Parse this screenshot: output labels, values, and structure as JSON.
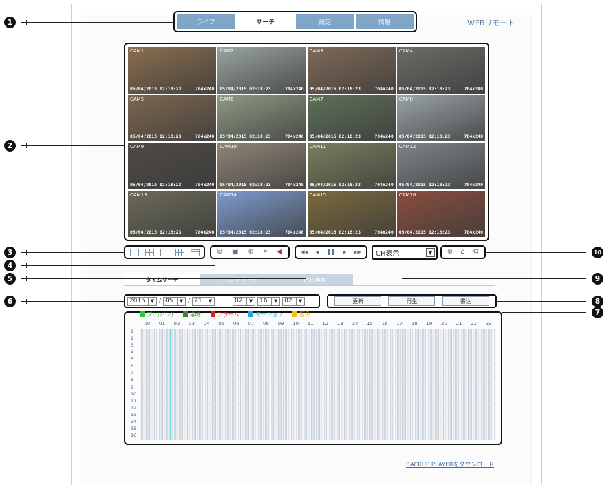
{
  "header": {
    "tabs": [
      {
        "label": "ライブ",
        "active": false
      },
      {
        "label": "サーチ",
        "active": true
      },
      {
        "label": "設定",
        "active": false
      },
      {
        "label": "情報",
        "active": false
      }
    ],
    "brand": "WEBリモート"
  },
  "callouts": [
    "1",
    "2",
    "3",
    "4",
    "5",
    "6",
    "7",
    "8",
    "9",
    "10"
  ],
  "cameras": [
    {
      "name": "CAM1",
      "date": "05/04/2015 02:18:23",
      "res": "704x240",
      "tone": "#8a6e4f"
    },
    {
      "name": "CAM2",
      "date": "05/04/2015 02:18:23",
      "res": "704x240",
      "tone": "#9aa4a0"
    },
    {
      "name": "CAM3",
      "date": "05/04/2015 02:18:23",
      "res": "704x240",
      "tone": "#7f6a57"
    },
    {
      "name": "CAM4",
      "date": "05/04/2015 02:18:23",
      "res": "704x240",
      "tone": "#6d6b67"
    },
    {
      "name": "CAM5",
      "date": "05/04/2015 02:18:23",
      "res": "704x240",
      "tone": "#7d6650"
    },
    {
      "name": "CAM6",
      "date": "05/04/2015 02:18:23",
      "res": "704x240",
      "tone": "#8e9a82"
    },
    {
      "name": "CAM7",
      "date": "05/04/2015 02:18:23",
      "res": "704x240",
      "tone": "#5e7058"
    },
    {
      "name": "CAM8",
      "date": "05/04/2015 02:18:23",
      "res": "704x240",
      "tone": "#9aa3a6"
    },
    {
      "name": "CAM9",
      "date": "05/04/2015 02:18:23",
      "res": "704x240",
      "tone": "#4e4a45"
    },
    {
      "name": "CAM10",
      "date": "05/04/2015 02:18:23",
      "res": "704x240",
      "tone": "#8f8577"
    },
    {
      "name": "CAM11",
      "date": "05/04/2015 02:18:23",
      "res": "704x240",
      "tone": "#7a7f5e"
    },
    {
      "name": "CAM12",
      "date": "05/04/2015 02:18:23",
      "res": "704x240",
      "tone": "#7e8689"
    },
    {
      "name": "CAM13",
      "date": "05/04/2015 02:18:23",
      "res": "704x240",
      "tone": "#6b6a58"
    },
    {
      "name": "CAM14",
      "date": "05/04/2015 02:18:23",
      "res": "704x240",
      "tone": "#7d9ccf"
    },
    {
      "name": "CAM15",
      "date": "05/04/2015 02:18:23",
      "res": "704x240",
      "tone": "#7b6a3e"
    },
    {
      "name": "CAM16",
      "date": "05/04/2015 02:18:23",
      "res": "704x240",
      "tone": "#8a4e3e"
    }
  ],
  "channel_select": {
    "value": "CH表示"
  },
  "search_tabs": [
    {
      "label": "タイムサーチ",
      "active": true
    },
    {
      "label": "イベントサーチ",
      "active": false
    },
    {
      "label": "POS検索",
      "active": false
    }
  ],
  "date": {
    "year": "2015",
    "month": "05",
    "day": "21",
    "hour": "02",
    "minute": "16",
    "second": "02",
    "sep": "/"
  },
  "actions": {
    "refresh": "更新",
    "play": "再生",
    "write": "書込"
  },
  "legend": [
    {
      "label": "プリ(パン)",
      "color": "#39c23f"
    },
    {
      "label": "常時",
      "color": "#3a8a2e"
    },
    {
      "label": "アラーム",
      "color": "#e51a1a"
    },
    {
      "label": "モーション",
      "color": "#2aa7e6"
    },
    {
      "label": "緊急",
      "color": "#f0c020"
    }
  ],
  "timeline": {
    "hours": [
      "00",
      "01",
      "02",
      "03",
      "04",
      "05",
      "06",
      "07",
      "08",
      "09",
      "10",
      "11",
      "12",
      "13",
      "14",
      "15",
      "16",
      "17",
      "18",
      "19",
      "20",
      "21",
      "22",
      "23"
    ],
    "channels": [
      "1",
      "2",
      "3",
      "4",
      "5",
      "6",
      "7",
      "8",
      "9",
      "10",
      "11",
      "12",
      "13",
      "14",
      "15",
      "16"
    ],
    "cursor_hour": 2.1,
    "cursor_color": "#3fd0f0"
  },
  "download_link": "BACKUP PLAYERをダウンロード"
}
